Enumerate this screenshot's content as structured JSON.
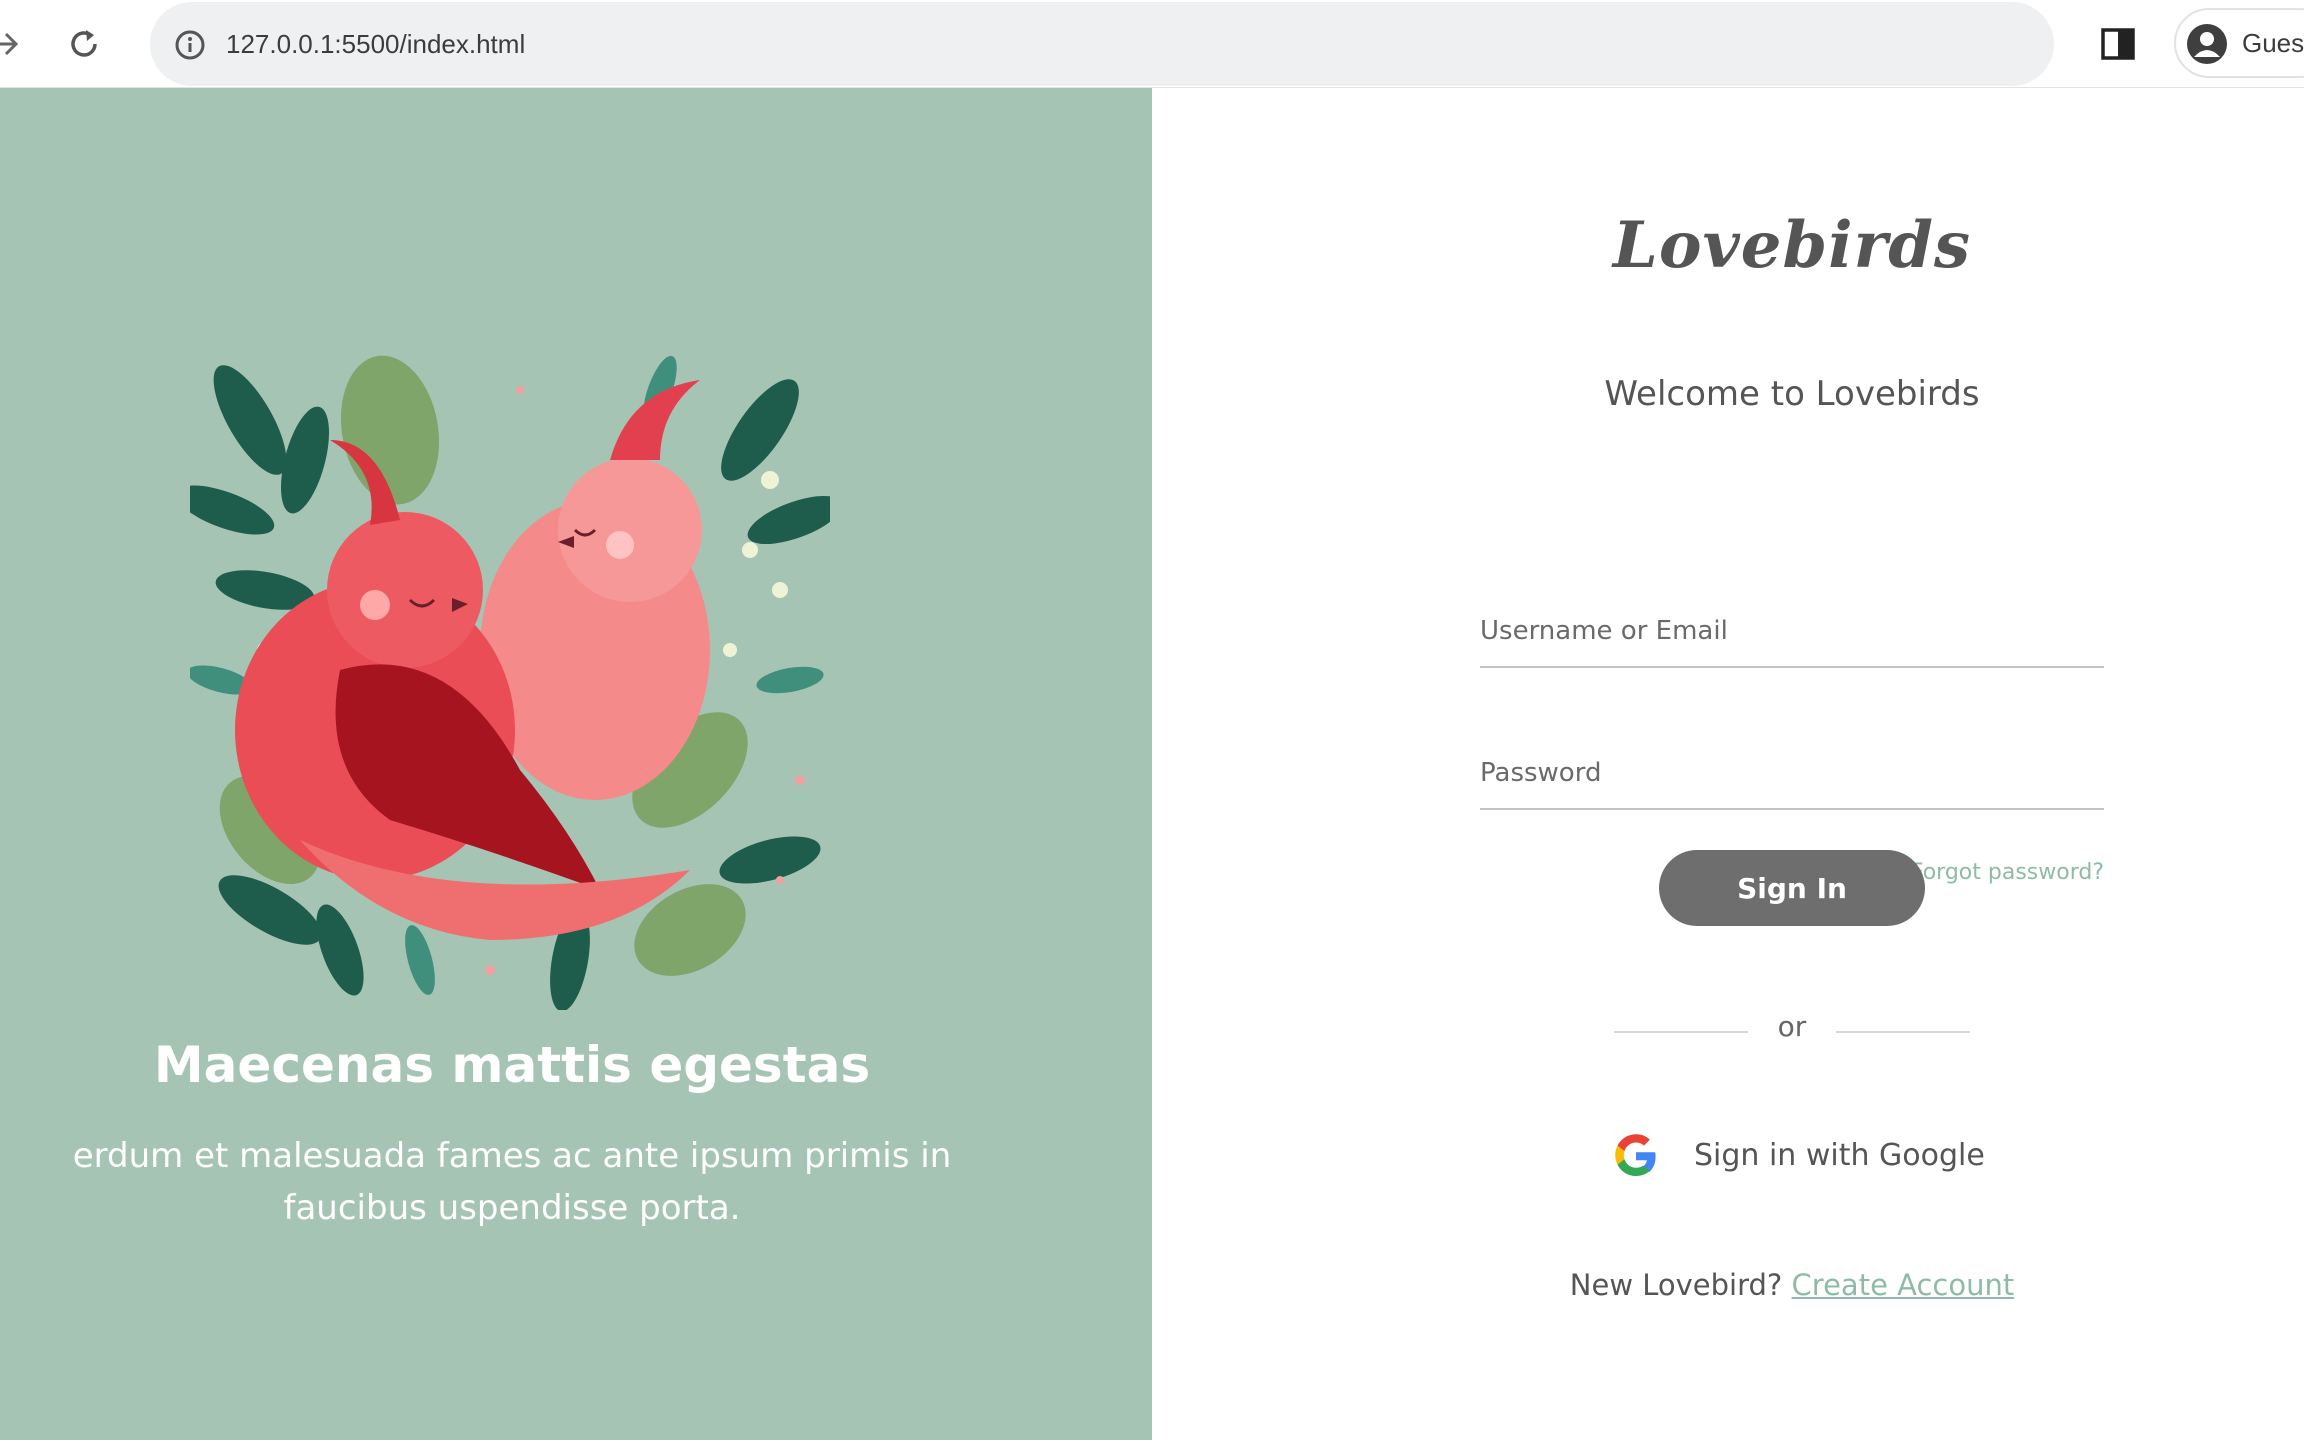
{
  "browser": {
    "url": "127.0.0.1:5500/index.html",
    "profile_label": "Guest",
    "icons": [
      "forward-arrow-icon",
      "reload-icon",
      "info-icon",
      "side-panel-icon",
      "profile-avatar-icon"
    ]
  },
  "hero": {
    "heading": "Maecenas mattis egestas",
    "body": "erdum et malesuada fames ac ante ipsum primis in faucibus uspendisse porta.",
    "illustration": "lovebirds-illustration",
    "background_color": "#a6c4b4"
  },
  "login": {
    "logo": "Lovebirds",
    "welcome": "Welcome to Lovebirds",
    "username_placeholder": "Username or Email",
    "password_placeholder": "Password",
    "forgot_password": "Forgot password?",
    "sign_in_label": "Sign In",
    "divider_label": "or",
    "google_label": "Sign in with Google",
    "new_account_prompt": "New Lovebird?",
    "create_account_label": "Create Account",
    "accent_color": "#8fbba6",
    "button_color": "#6e6e6e"
  }
}
